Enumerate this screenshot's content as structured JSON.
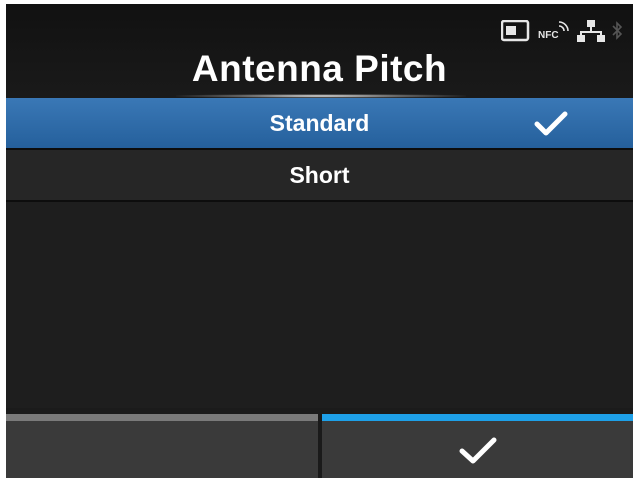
{
  "header": {
    "title": "Antenna Pitch",
    "status_icons": [
      {
        "name": "sd-card-icon"
      },
      {
        "name": "nfc-icon",
        "label": "NFC"
      },
      {
        "name": "network-icon"
      },
      {
        "name": "bluetooth-icon"
      }
    ]
  },
  "options": [
    {
      "label": "Standard",
      "selected": true
    },
    {
      "label": "Short",
      "selected": false
    }
  ],
  "soft_keys": {
    "left": {
      "label": ""
    },
    "right": {
      "icon": "checkmark-icon"
    }
  },
  "colors": {
    "background": "#1b1b1b",
    "selected_row": "#2e6ca9",
    "confirm_accent": "#1ea0e8",
    "left_key_accent": "#7a7a7a",
    "text": "#ffffff"
  }
}
